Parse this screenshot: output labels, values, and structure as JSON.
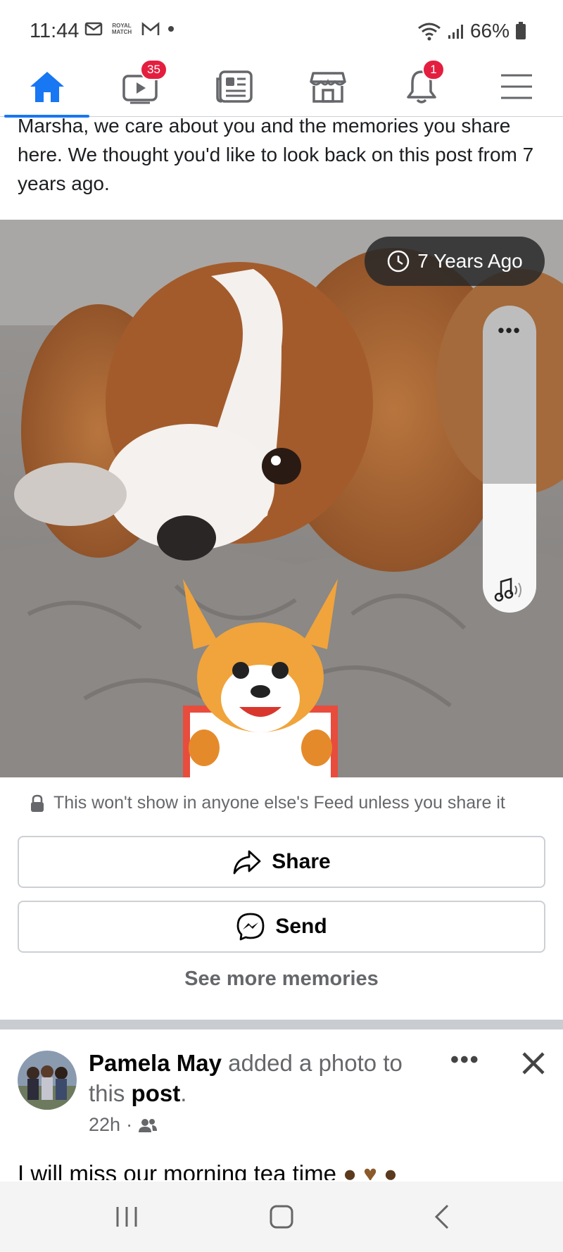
{
  "status_bar": {
    "time": "11:44",
    "notif_badge_text": "ROYAL MATCH",
    "battery": "66%"
  },
  "nav": {
    "items": [
      {
        "name": "Home",
        "badge": ""
      },
      {
        "name": "Watch",
        "badge": "35"
      },
      {
        "name": "News",
        "badge": ""
      },
      {
        "name": "Marketplace",
        "badge": ""
      },
      {
        "name": "Notifications",
        "badge": "1"
      },
      {
        "name": "Menu",
        "badge": ""
      }
    ]
  },
  "memory": {
    "message": "Marsha, we care about you and the memories you share here. We thought you'd like to look back on this post from 7 years ago.",
    "years_ago": "7 Years Ago",
    "volume_level_fraction": 0.42,
    "privacy_note": "This won't show in anyone else's Feed unless you share it",
    "share_label": "Share",
    "send_label": "Send",
    "see_more_label": "See more memories"
  },
  "post": {
    "author": "Pamela May",
    "action_text": " added a photo to this ",
    "post_word": "post",
    "period": ".",
    "time": "22h",
    "meta_sep": "·",
    "text": "I will miss our morning tea time"
  },
  "colors": {
    "accent": "#1877f2",
    "badge": "#e41e3f",
    "secondary_text": "#65676b"
  }
}
